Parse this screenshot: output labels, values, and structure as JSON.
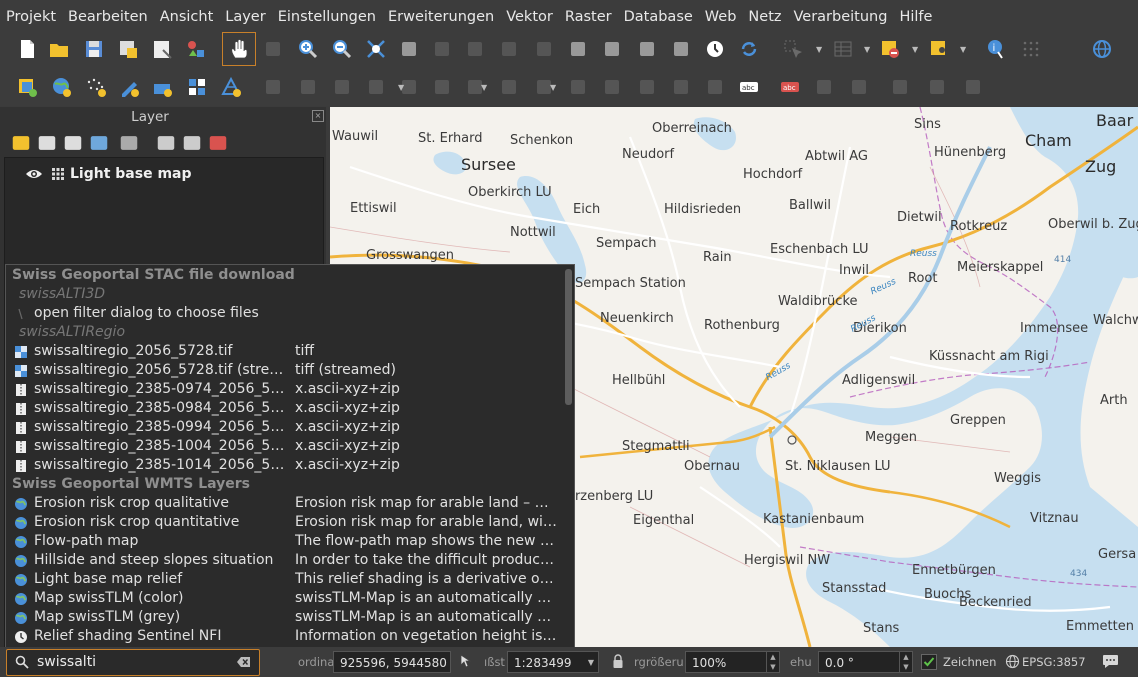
{
  "menu": [
    "Projekt",
    "Bearbeiten",
    "Ansicht",
    "Layer",
    "Einstellungen",
    "Erweiterungen",
    "Vektor",
    "Raster",
    "Database",
    "Web",
    "Netz",
    "Verarbeitung",
    "Hilfe"
  ],
  "toolbar1_icons": [
    "new-project-icon",
    "open-project-icon",
    "save-project-icon",
    "save-as-icon",
    "print-layout-icon",
    "style-manager-icon",
    "pan-icon",
    "pan-to-selection-icon",
    "zoom-in-icon",
    "zoom-out-icon",
    "zoom-full-icon",
    "zoom-to-selection-icon",
    "zoom-to-layer-icon",
    "zoom-native-icon",
    "zoom-last-icon",
    "zoom-next-icon",
    "new-map-view-icon",
    "new-3d-view-icon",
    "new-bookmark-icon",
    "show-bookmarks-icon",
    "temporal-controller-icon",
    "refresh-icon",
    "select-features-icon",
    "attribute-table-icon",
    "deselect-icon",
    "select-location-icon",
    "identify-icon",
    "measure-icon",
    "browser-icon"
  ],
  "toolbar2_icons": [
    "data-source-manager-icon",
    "add-wms-icon",
    "add-point-cloud-icon",
    "digitize-icon",
    "new-layer-icon",
    "new-temp-layer-icon",
    "new-mesh-icon",
    "edit-pencil-icon",
    "toggle-edit-icon",
    "save-edits-icon",
    "add-feature-icon",
    "vertex-tool-icon",
    "move-feature-icon",
    "delete-feature-icon",
    "cut-icon",
    "copy-icon",
    "paste-icon",
    "undo-icon",
    "redo-icon",
    "label-tool-icon",
    "pin-labels-icon",
    "label-abc-icon",
    "label-abc-red-icon",
    "show-labels-icon",
    "move-label-icon",
    "rotate-label-icon",
    "change-label-icon",
    "snap-icon"
  ],
  "layers": {
    "title": "Layer",
    "items": [
      {
        "label": "Light base map",
        "visible": true
      }
    ]
  },
  "locator": {
    "rows": [
      {
        "kind": "group",
        "name": "Swiss Geoportal STAC file download"
      },
      {
        "kind": "sub",
        "name": "swissALTI3D"
      },
      {
        "kind": "item",
        "icon": "filter-icon",
        "name": "open filter dialog to choose files",
        "desc": ""
      },
      {
        "kind": "sub",
        "name": "swissALTIRegio"
      },
      {
        "kind": "item",
        "icon": "raster-tile-icon",
        "name": "swissaltiregio_2056_5728.tif",
        "desc": "tiff"
      },
      {
        "kind": "item",
        "icon": "raster-tile-icon",
        "name": "swissaltiregio_2056_5728.tif (strea...",
        "desc": "tiff (streamed)"
      },
      {
        "kind": "item",
        "icon": "zip-file-icon",
        "name": "swissaltiregio_2385-0974_2056_57...",
        "desc": "x.ascii-xyz+zip"
      },
      {
        "kind": "item",
        "icon": "zip-file-icon",
        "name": "swissaltiregio_2385-0984_2056_57...",
        "desc": "x.ascii-xyz+zip"
      },
      {
        "kind": "item",
        "icon": "zip-file-icon",
        "name": "swissaltiregio_2385-0994_2056_57...",
        "desc": "x.ascii-xyz+zip"
      },
      {
        "kind": "item",
        "icon": "zip-file-icon",
        "name": "swissaltiregio_2385-1004_2056_57...",
        "desc": "x.ascii-xyz+zip"
      },
      {
        "kind": "item",
        "icon": "zip-file-icon",
        "name": "swissaltiregio_2385-1014_2056_57...",
        "desc": "x.ascii-xyz+zip"
      },
      {
        "kind": "group",
        "name": "Swiss Geoportal WMTS Layers"
      },
      {
        "kind": "item",
        "icon": "globe-icon",
        "name": "Erosion risk crop qualitative",
        "desc": "Erosion risk map for arable land – qu..."
      },
      {
        "kind": "item",
        "icon": "globe-icon",
        "name": "Erosion risk crop quantitative",
        "desc": "Erosion risk map for arable land, wit..."
      },
      {
        "kind": "item",
        "icon": "globe-icon",
        "name": "Flow-path map",
        "desc": "The flow-path map shows the new c..."
      },
      {
        "kind": "item",
        "icon": "globe-icon",
        "name": "Hillside and steep slopes situation",
        "desc": "In order to take the difficult product..."
      },
      {
        "kind": "item",
        "icon": "globe-icon",
        "name": "Light base map relief",
        "desc": "This relief shading is a derivative of t..."
      },
      {
        "kind": "item",
        "icon": "globe-icon",
        "name": "Map swissTLM (color)",
        "desc": "swissTLM-Map is an automatically ge..."
      },
      {
        "kind": "item",
        "icon": "globe-icon",
        "name": "Map swissTLM (grey)",
        "desc": "swissTLM-Map is an automatically ge..."
      },
      {
        "kind": "item",
        "icon": "time-globe-icon",
        "name": "Relief shading Sentinel NFI",
        "desc": "Information on vegetation height is ..."
      }
    ]
  },
  "map_places": [
    {
      "name": "Wauwil",
      "size": "normal"
    },
    {
      "name": "St. Erhard",
      "size": "normal"
    },
    {
      "name": "Schenkon",
      "size": "normal"
    },
    {
      "name": "Oberreinach",
      "size": "normal"
    },
    {
      "name": "Sins",
      "size": "normal"
    },
    {
      "name": "Baar",
      "size": "big"
    },
    {
      "name": "Sursee",
      "size": "big"
    },
    {
      "name": "Neudorf",
      "size": "normal"
    },
    {
      "name": "Abtwil AG",
      "size": "normal"
    },
    {
      "name": "Hünenberg",
      "size": "normal"
    },
    {
      "name": "Cham",
      "size": "big"
    },
    {
      "name": "Oberkirch LU",
      "size": "normal"
    },
    {
      "name": "Hochdorf",
      "size": "normal"
    },
    {
      "name": "Zug",
      "size": "big"
    },
    {
      "name": "Ettiswil",
      "size": "normal"
    },
    {
      "name": "Eich",
      "size": "normal"
    },
    {
      "name": "Hildisrieden",
      "size": "normal"
    },
    {
      "name": "Ballwil",
      "size": "normal"
    },
    {
      "name": "Dietwil",
      "size": "normal"
    },
    {
      "name": "Nottwil",
      "size": "normal"
    },
    {
      "name": "Rotkreuz",
      "size": "normal"
    },
    {
      "name": "Oberwil b. Zug",
      "size": "normal"
    },
    {
      "name": "Sempach",
      "size": "normal"
    },
    {
      "name": "Eschenbach LU",
      "size": "normal"
    },
    {
      "name": "Grosswangen",
      "size": "normal"
    },
    {
      "name": "Rain",
      "size": "normal"
    },
    {
      "name": "Inwil",
      "size": "normal"
    },
    {
      "name": "Meierskappel",
      "size": "normal"
    },
    {
      "name": "Sempach Station",
      "size": "normal"
    },
    {
      "name": "Root",
      "size": "normal"
    },
    {
      "name": "Waldibrücke",
      "size": "normal"
    },
    {
      "name": "Neuenkirch",
      "size": "normal"
    },
    {
      "name": "Walchwil",
      "size": "normal"
    },
    {
      "name": "Rothenburg",
      "size": "normal"
    },
    {
      "name": "Dierikon",
      "size": "normal"
    },
    {
      "name": "Immensee",
      "size": "normal"
    },
    {
      "name": "Küssnacht am Rigi",
      "size": "normal"
    },
    {
      "name": "Hellbühl",
      "size": "normal"
    },
    {
      "name": "Adligenswil",
      "size": "normal"
    },
    {
      "name": "Arth",
      "size": "normal"
    },
    {
      "name": "Greppen",
      "size": "normal"
    },
    {
      "name": "Meggen",
      "size": "normal"
    },
    {
      "name": "Stegmattli",
      "size": "normal"
    },
    {
      "name": "Obernau",
      "size": "normal"
    },
    {
      "name": "St. Niklausen LU",
      "size": "normal"
    },
    {
      "name": "Weggis",
      "size": "normal"
    },
    {
      "name": "arzenberg LU",
      "size": "normal"
    },
    {
      "name": "Eigenthal",
      "size": "normal"
    },
    {
      "name": "Kastanienbaum",
      "size": "normal"
    },
    {
      "name": "Vitznau",
      "size": "normal"
    },
    {
      "name": "Hergiswil NW",
      "size": "normal"
    },
    {
      "name": "Gersa",
      "size": "normal"
    },
    {
      "name": "Ennetbürgen",
      "size": "normal"
    },
    {
      "name": "Stansstad",
      "size": "normal"
    },
    {
      "name": "Buochs",
      "size": "normal"
    },
    {
      "name": "Beckenried",
      "size": "normal"
    },
    {
      "name": "Stans",
      "size": "normal"
    },
    {
      "name": "Emmetten",
      "size": "normal"
    }
  ],
  "map_water_labels": [
    "Reuss",
    "Reuss",
    "Reuss",
    "Reuss"
  ],
  "road_numbers": [
    "414",
    "434"
  ],
  "status": {
    "search_value": "swissalti",
    "coord_label": "ordina",
    "coord_value": "925596, 5944580",
    "scale_label": "ıßst",
    "scale_value": "1:283499",
    "magnifier_label": "rgrößeru",
    "magnifier_value": "100%",
    "rotation_label": "ehu",
    "rotation_value": "0.0 °",
    "render_label": "Zeichnen",
    "crs_label": "EPSG:3857"
  },
  "colors": {
    "highway": "#f0b33c",
    "road": "#ffffff",
    "lake": "#c6dff0",
    "border": "#b04bb7",
    "accent": "#c8802a"
  }
}
